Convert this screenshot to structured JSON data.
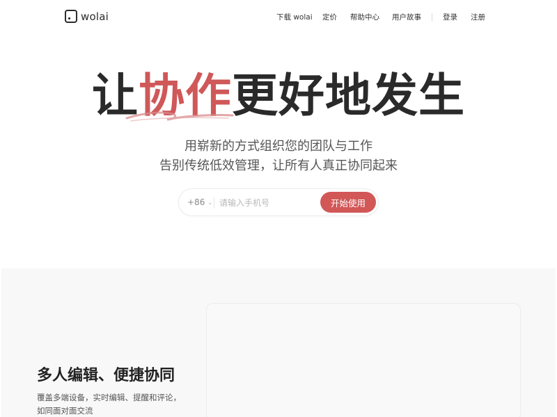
{
  "header": {
    "logo_text": "wolai",
    "nav": {
      "download": "下载 wolai",
      "pricing": "定价",
      "help": "帮助中心",
      "stories": "用户故事",
      "login": "登录",
      "register": "注册"
    }
  },
  "hero": {
    "title_prefix": "让",
    "title_accent": "协作",
    "title_suffix": "更好地发生",
    "subtitle_line1": "用崭新的方式组织您的团队与工作",
    "subtitle_line2": "告别传统低效管理，让所有人真正协同起来"
  },
  "signup": {
    "country_code": "+86",
    "phone_placeholder": "请输入手机号",
    "button_label": "开始使用"
  },
  "feature": {
    "title": "多人编辑、便捷协同",
    "description": "覆盖多端设备，实时编辑、提醒和评论，如同面对面交流"
  },
  "colors": {
    "accent": "#cf5859",
    "button": "#d25757",
    "section_bg": "#f8f8f8"
  },
  "icons": {
    "logo": "wolai-logo-icon",
    "country_dropdown": "chevron-down-icon",
    "accent_underline": "scribble-underline"
  }
}
